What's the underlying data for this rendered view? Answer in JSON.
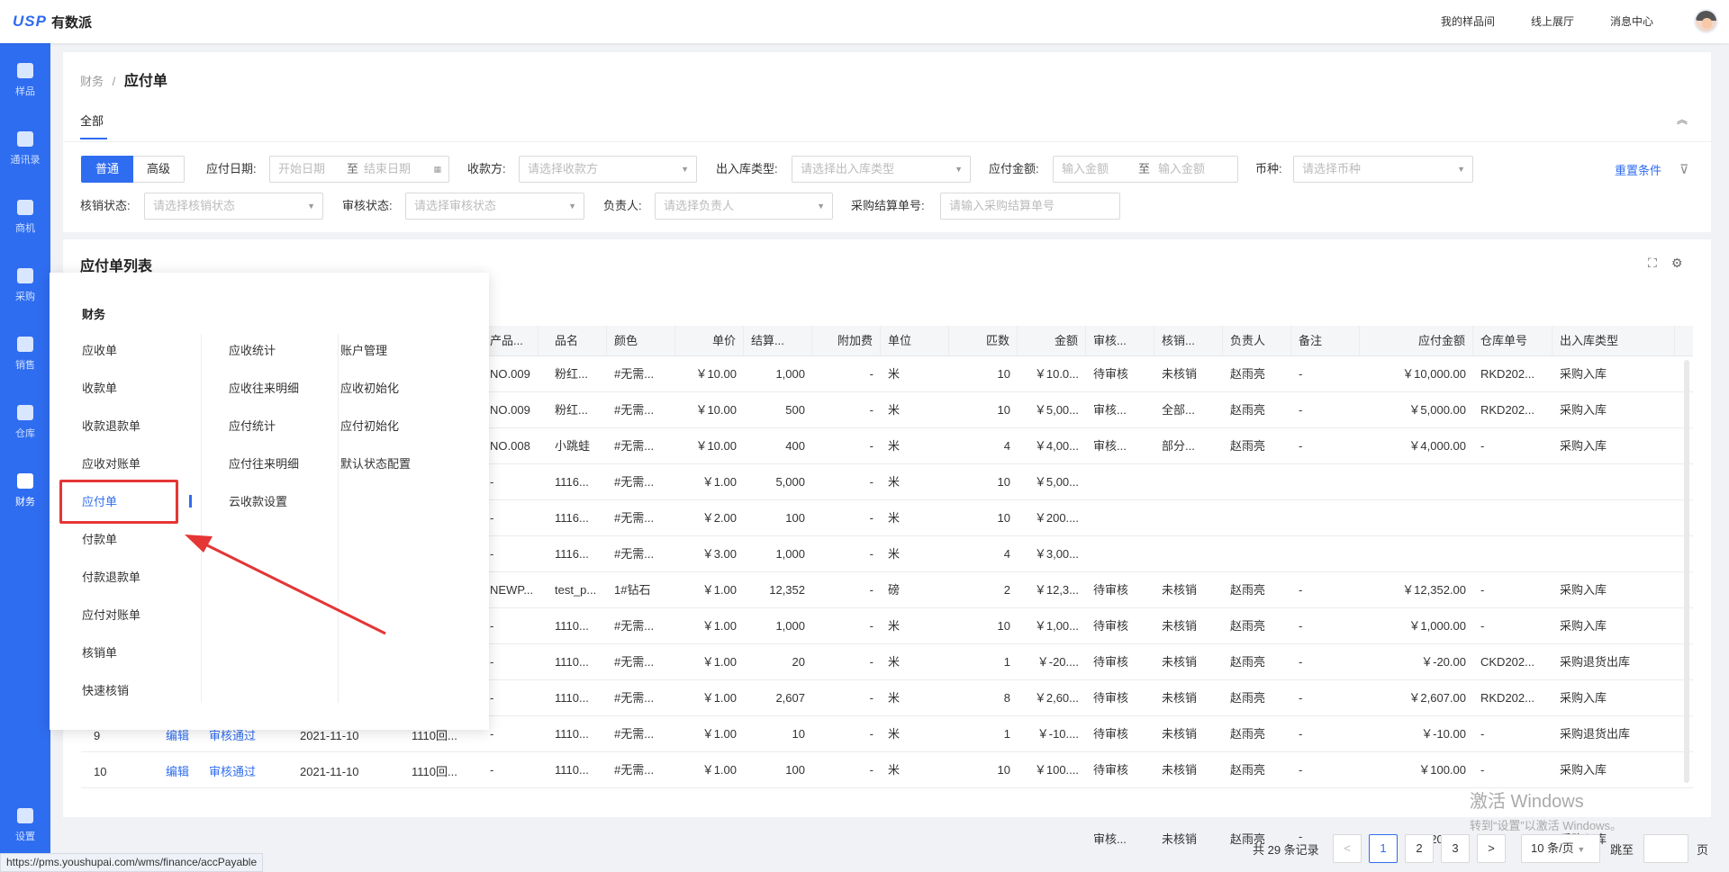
{
  "app": {
    "logo_mark": "USP",
    "logo_name": "有数派"
  },
  "topnav": [
    "我的样品间",
    "线上展厅",
    "消息中心"
  ],
  "sidebar": [
    {
      "label": "样品",
      "icon": "box-icon"
    },
    {
      "label": "通讯录",
      "icon": "contacts-icon"
    },
    {
      "label": "商机",
      "icon": "lightbulb-icon"
    },
    {
      "label": "采购",
      "icon": "cart-icon"
    },
    {
      "label": "销售",
      "icon": "clipboard-icon"
    },
    {
      "label": "仓库",
      "icon": "warehouse-icon"
    },
    {
      "label": "财务",
      "icon": "money-bag-icon"
    },
    {
      "label": "设置",
      "icon": "gear-icon"
    }
  ],
  "breadcrumb": {
    "parent": "财务",
    "sep": "/",
    "current": "应付单"
  },
  "tab_all": "全部",
  "filters": {
    "mode_normal": "普通",
    "mode_advanced": "高级",
    "pay_date_label": "应付日期:",
    "start_date_ph": "开始日期",
    "to": "至",
    "end_date_ph": "结束日期",
    "payee_label": "收款方:",
    "payee_ph": "请选择收款方",
    "io_type_label": "出入库类型:",
    "io_type_ph": "请选择出入库类型",
    "amount_label": "应付金额:",
    "amount_min_ph": "输入金额",
    "amount_max_ph": "输入金额",
    "currency_label": "币种:",
    "currency_ph": "请选择币种",
    "reset": "重置条件",
    "writeoff_label": "核销状态:",
    "writeoff_ph": "请选择核销状态",
    "audit_label": "审核状态:",
    "audit_ph": "请选择审核状态",
    "owner_label": "负责人:",
    "owner_ph": "请选择负责人",
    "po_no_label": "采购结算单号:",
    "po_no_ph": "请输入采购结算单号"
  },
  "list_title": "应付单列表",
  "table": {
    "headers": [
      "产品...",
      "品名",
      "颜色",
      "单价",
      "结算...",
      "附加费",
      "单位",
      "匹数",
      "金额",
      "审核...",
      "核销...",
      "负责人",
      "备注",
      "应付金额",
      "仓库单号",
      "出入库类型"
    ],
    "rows": [
      [
        "NO.009",
        "粉红...",
        "#无需...",
        "￥10.00",
        "1,000",
        "-",
        "米",
        "10",
        "￥10.0...",
        "待审核",
        "未核销",
        "赵雨亮",
        "-",
        "￥10,000.00",
        "RKD202...",
        "采购入库"
      ],
      [
        "NO.009",
        "粉红...",
        "#无需...",
        "￥10.00",
        "500",
        "-",
        "米",
        "10",
        "￥5,00...",
        "审核...",
        "全部...",
        "赵雨亮",
        "-",
        "￥5,000.00",
        "RKD202...",
        "采购入库"
      ],
      [
        "NO.008",
        "小跳蛙",
        "#无需...",
        "￥10.00",
        "400",
        "-",
        "米",
        "4",
        "￥4,00...",
        "审核...",
        "部分...",
        "赵雨亮",
        "-",
        "￥4,000.00",
        "-",
        "采购入库"
      ],
      [
        "-",
        "1116...",
        "#无需...",
        "￥1.00",
        "5,000",
        "-",
        "米",
        "10",
        "￥5,00...",
        "",
        "",
        "",
        "",
        "",
        "",
        ""
      ],
      [
        "-",
        "1116...",
        "#无需...",
        "￥2.00",
        "100",
        "-",
        "米",
        "10",
        "￥200....",
        "",
        "",
        "",
        "",
        "",
        "",
        ""
      ],
      [
        "-",
        "1116...",
        "#无需...",
        "￥3.00",
        "1,000",
        "-",
        "米",
        "4",
        "￥3,00...",
        "",
        "",
        "",
        "",
        "",
        "",
        ""
      ],
      [
        "NEWP...",
        "test_p...",
        "1#钻石",
        "￥1.00",
        "12,352",
        "-",
        "磅",
        "2",
        "￥12,3...",
        "待审核",
        "未核销",
        "赵雨亮",
        "-",
        "￥12,352.00",
        "-",
        "采购入库"
      ],
      [
        "-",
        "1110...",
        "#无需...",
        "￥1.00",
        "1,000",
        "-",
        "米",
        "10",
        "￥1,00...",
        "待审核",
        "未核销",
        "赵雨亮",
        "-",
        "￥1,000.00",
        "-",
        "采购入库"
      ],
      [
        "-",
        "1110...",
        "#无需...",
        "￥1.00",
        "20",
        "-",
        "米",
        "1",
        "￥-20....",
        "待审核",
        "未核销",
        "赵雨亮",
        "-",
        "￥-20.00",
        "CKD202...",
        "采购退货出库"
      ],
      [
        "-",
        "1110...",
        "#无需...",
        "￥1.00",
        "2,607",
        "-",
        "米",
        "8",
        "￥2,60...",
        "待审核",
        "未核销",
        "赵雨亮",
        "-",
        "￥2,607.00",
        "RKD202...",
        "采购入库"
      ],
      [
        "-",
        "1110...",
        "#无需...",
        "￥1.00",
        "10",
        "-",
        "米",
        "1",
        "￥-10....",
        "待审核",
        "未核销",
        "赵雨亮",
        "-",
        "￥-10.00",
        "-",
        "采购退货出库"
      ],
      [
        "-",
        "1110...",
        "#无需...",
        "￥1.00",
        "100",
        "-",
        "米",
        "10",
        "￥100....",
        "待审核",
        "未核销",
        "赵雨亮",
        "-",
        "￥100.00",
        "-",
        "采购入库"
      ]
    ],
    "merged": {
      "audit": "审核...",
      "writeoff": "未核销",
      "owner": "赵雨亮",
      "remark": "-",
      "payable": "￥8,200.00",
      "wh": "-",
      "type": "采购入库"
    },
    "left_rows": [
      {
        "no": "9",
        "edit": "编辑",
        "status": "审核通过",
        "date": "2021-11-10",
        "code": "1110回..."
      },
      {
        "no": "10",
        "edit": "编辑",
        "status": "审核通过",
        "date": "2021-11-10",
        "code": "1110回..."
      }
    ]
  },
  "menu": {
    "title": "财务",
    "col1": [
      "应收单",
      "收款单",
      "收款退款单",
      "应收对账单",
      "应付单",
      "付款单",
      "付款退款单",
      "应付对账单",
      "核销单",
      "快速核销"
    ],
    "col2": [
      "应收统计",
      "应收往来明细",
      "应付统计",
      "应付往来明细",
      "云收款设置"
    ],
    "col3": [
      "账户管理",
      "应收初始化",
      "应付初始化",
      "默认状态配置"
    ],
    "active": "应付单",
    "accent": "#2f6df0",
    "annotation_color": "#e53535"
  },
  "pagination": {
    "total": "共 29 条记录",
    "pages": [
      "1",
      "2",
      "3"
    ],
    "current": "1",
    "page_size": "10 条/页",
    "jump": "跳至",
    "page_suffix": "页",
    "prev": "<",
    "next": ">"
  },
  "status_url": "https://pms.youshupai.com/wms/finance/accPayable",
  "watermark": {
    "line1": "激活 Windows",
    "line2": "转到“设置”以激活 Windows。"
  }
}
